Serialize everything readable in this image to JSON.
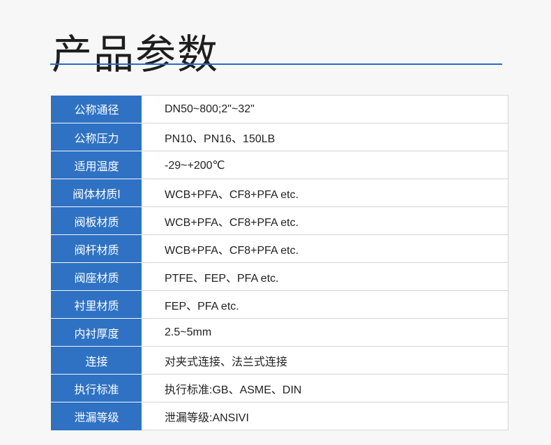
{
  "page": {
    "title": "产品参数",
    "accent_color": "#2f72c4"
  },
  "params": [
    {
      "label": "公称通径",
      "value": "DN50~800;2\"~32\""
    },
    {
      "label": "公称压力",
      "value": "PN10、PN16、150LB"
    },
    {
      "label": "适用温度",
      "value": "-29~+200℃"
    },
    {
      "label": "阀体材质l",
      "value": "WCB+PFA、CF8+PFA  etc."
    },
    {
      "label": "阀板材质",
      "value": "WCB+PFA、CF8+PFA   etc."
    },
    {
      "label": "阀杆材质",
      "value": "WCB+PFA、CF8+PFA  etc."
    },
    {
      "label": "阀座材质",
      "value": "PTFE、FEP、PFA etc."
    },
    {
      "label": "衬里材质",
      "value": "FEP、PFA etc."
    },
    {
      "label": "内衬厚度",
      "value": "2.5~5mm"
    },
    {
      "label": "连接",
      "value": "对夹式连接、法兰式连接"
    },
    {
      "label": "执行标准",
      "value": "执行标准:GB、ASME、DIN"
    },
    {
      "label": "泄漏等级",
      "value": "泄漏等级:ANSIVI"
    }
  ]
}
